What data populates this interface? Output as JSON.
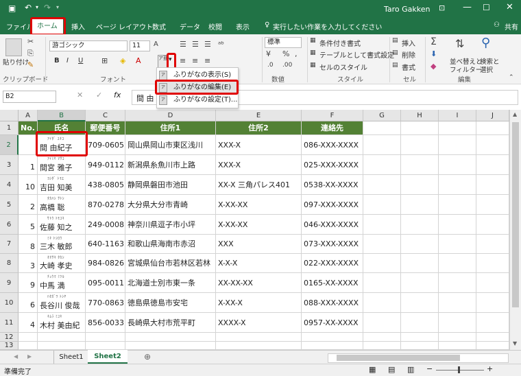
{
  "colors": {
    "accent": "#217346",
    "header_fill": "#538135",
    "highlight": "#e00000"
  },
  "user": "Taro Gakken",
  "tabs": [
    "ファイル",
    "ホーム",
    "挿入",
    "ページ レイアウト",
    "数式",
    "データ",
    "校閲",
    "表示"
  ],
  "tell_me": "実行したい作業を入力してください",
  "share": "共有",
  "ribbon": {
    "paste": "貼り付け",
    "clipboard": "クリップボード",
    "font_name": "游ゴシック",
    "font_size": "11",
    "font_group": "フォント",
    "number_format": "標準",
    "number_group": "数値",
    "cond_format": "条件付き書式",
    "table_format": "テーブルとして書式設定",
    "cell_style": "セルのスタイル",
    "style_group": "スタイル",
    "insert": "挿入",
    "delete": "削除",
    "format": "書式",
    "cells_group": "セル",
    "sort_filter_1": "並べ替えと",
    "sort_filter_2": "フィルター",
    "find_1": "検索と",
    "find_2": "選択",
    "edit_group": "編集",
    "bold": "B",
    "italic": "I",
    "underline": "U"
  },
  "furigana_menu": [
    "ふりがなの表示(S)",
    "ふりがなの編集(E)",
    "ふりがなの設定(T)..."
  ],
  "name_box": "B2",
  "formula": "間 由",
  "columns": [
    "A",
    "B",
    "C",
    "D",
    "E",
    "F",
    "G",
    "H",
    "I",
    "J"
  ],
  "rows": [
    "1",
    "2",
    "3",
    "4",
    "5",
    "6",
    "7",
    "8",
    "9",
    "10",
    "11",
    "12",
    "13"
  ],
  "headers": [
    "No.",
    "氏名",
    "郵便番号",
    "住所1",
    "住所2",
    "連絡先"
  ],
  "data": [
    {
      "no": "",
      "furi": "ｱｲﾀﾞ ﾕｷｺ",
      "name": "間 由紀子",
      "zip": "709-0605",
      "addr1": "岡山県岡山市東区浅川",
      "addr2": "XXX-X",
      "tel": "086-XXX-XXXX"
    },
    {
      "no": "1",
      "furi": "ｱｲﾐﾔ ﾏｻｺ",
      "name": "間宮 雅子",
      "zip": "949-0112",
      "addr1": "新潟県糸魚川市上路",
      "addr2": "XXX-X",
      "tel": "025-XXX-XXXX"
    },
    {
      "no": "10",
      "furi": "ﾖｼﾀﾞ ﾄﾓｴ",
      "name": "吉田 知美",
      "zip": "438-0805",
      "addr1": "静岡県磐田市池田",
      "addr2": "XX-X 三角パレス401",
      "tel": "0538-XX-XXXX"
    },
    {
      "no": "2",
      "furi": "ﾀｶﾊｼ ｻﾄｼ",
      "name": "高橋 聡",
      "zip": "870-0278",
      "addr1": "大分県大分市青崎",
      "addr2": "X-XX-XX",
      "tel": "097-XXX-XXXX"
    },
    {
      "no": "5",
      "furi": "ｻﾄｳ ﾄﾓﾕｷ",
      "name": "佐藤 知之",
      "zip": "249-0008",
      "addr1": "神奈川県逗子市小坪",
      "addr2": "X-XX-XX",
      "tel": "046-XXX-XXXX"
    },
    {
      "no": "8",
      "furi": "ﾐｷ ﾄｼﾛｳ",
      "name": "三木 敏郎",
      "zip": "640-1163",
      "addr1": "和歌山県海南市赤沼",
      "addr2": "XXX",
      "tel": "073-XXX-XXXX"
    },
    {
      "no": "3",
      "furi": "ｵｵｻｷ ﾀｶｼ",
      "name": "大崎 孝史",
      "zip": "984-0826",
      "addr1": "宮城県仙台市若林区若林",
      "addr2": "X-X-X",
      "tel": "022-XXX-XXXX"
    },
    {
      "no": "9",
      "furi": "ﾁｭｳﾏ ﾐﾂﾙ",
      "name": "中馬 満",
      "zip": "095-0011",
      "addr1": "北海道士別市東一条",
      "addr2": "XX-XX-XX",
      "tel": "0165-XX-XXXX"
    },
    {
      "no": "6",
      "furi": "ﾊｾｶﾞﾜ ﾄｼﾔ",
      "name": "長谷川 俊哉",
      "zip": "770-0863",
      "addr1": "徳島県徳島市安宅",
      "addr2": "X-XX-X",
      "tel": "088-XXX-XXXX"
    },
    {
      "no": "4",
      "furi": "ｷﾑﾗ ﾐﾕｷ",
      "name": "木村 美由紀",
      "zip": "856-0033",
      "addr1": "長崎県大村市荒平町",
      "addr2": "XXXX-X",
      "tel": "0957-XX-XXXX"
    }
  ],
  "sheets": [
    "Sheet1",
    "Sheet2"
  ],
  "status": "準備完了"
}
